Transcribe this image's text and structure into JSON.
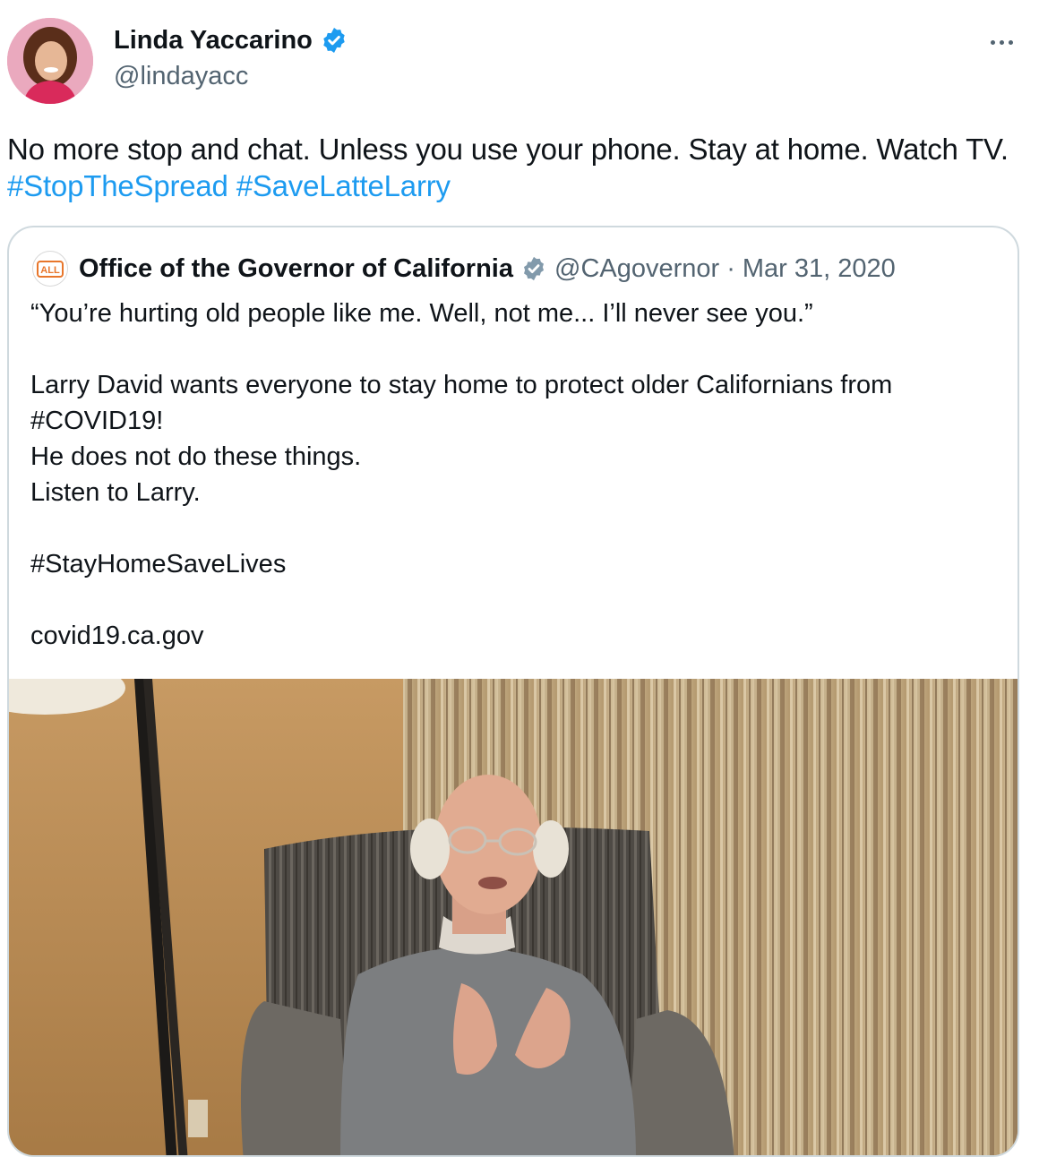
{
  "tweet": {
    "author": {
      "name": "Linda Yaccarino",
      "handle": "@lindayacc",
      "verified_color": "#1d9bf0"
    },
    "more_icon": "more-horizontal-icon",
    "text": "No more stop and chat. Unless you use your phone. Stay at home. Watch TV.",
    "hashtags": [
      "#StopTheSpread",
      "#SaveLatteLarry"
    ],
    "hashtag_color": "#1d9bf0"
  },
  "quote": {
    "author": {
      "name": "Office of the Governor of California",
      "handle": "@CAgovernor",
      "separator": "·",
      "date": "Mar 31, 2020",
      "avatar_text": "ALL",
      "badge_color": "#829aab"
    },
    "lines": [
      "“You’re hurting old people like me. Well, not me... I’ll never see you.”",
      "",
      "Larry David wants everyone to stay home to protect older Californians from",
      "#COVID19!",
      "He does not do these things.",
      "Listen to Larry.",
      "",
      "#StayHomeSaveLives",
      "",
      "covid19.ca.gov"
    ]
  }
}
